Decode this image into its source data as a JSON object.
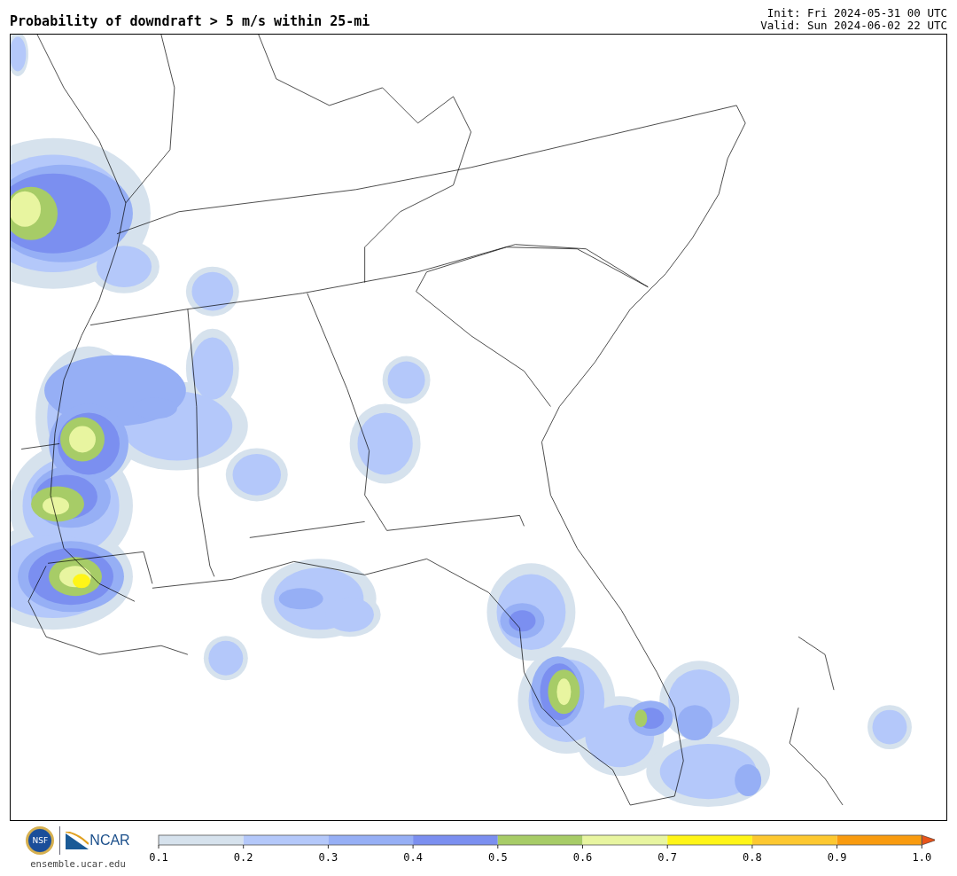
{
  "title": "Probability of downdraft > 5 m/s within 25-mi",
  "init": "Init: Fri 2024-05-31 00 UTC",
  "valid": "Valid: Sun 2024-06-02 22 UTC",
  "branding": {
    "nsf_logo_text": "NSF",
    "ncar_logo_text": "NCAR",
    "url": "ensemble.ucar.edu"
  },
  "colorbar": {
    "segments": [
      {
        "kind": "box",
        "color": "#d6e2ed"
      },
      {
        "kind": "box",
        "color": "#b4c8fa"
      },
      {
        "kind": "box",
        "color": "#96aff5"
      },
      {
        "kind": "box",
        "color": "#7b8ff0"
      },
      {
        "kind": "box",
        "color": "#a7cc67"
      },
      {
        "kind": "box",
        "color": "#e8f5a0"
      },
      {
        "kind": "box",
        "color": "#fff517"
      },
      {
        "kind": "box",
        "color": "#fdc830"
      },
      {
        "kind": "box",
        "color": "#f99b0f"
      },
      {
        "kind": "arrow",
        "color": "#e8541a"
      }
    ],
    "ticks": [
      "0.1",
      "0.2",
      "0.3",
      "0.4",
      "0.5",
      "0.6",
      "0.7",
      "0.8",
      "0.9",
      "1.0"
    ]
  }
}
